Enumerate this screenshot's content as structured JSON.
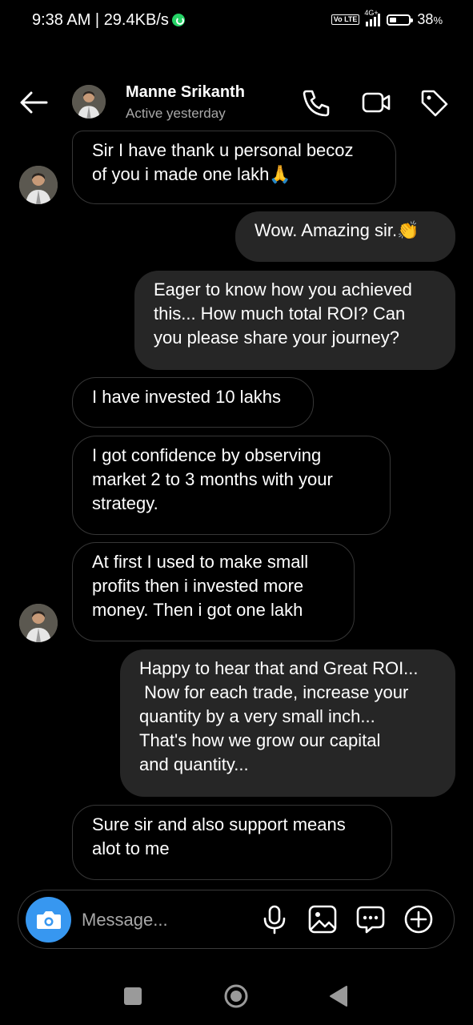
{
  "status_bar": {
    "time": "9:38 AM | 29.4KB/s",
    "volte": "Vo LTE",
    "network": "4G+",
    "battery": "38",
    "battery_unit": "%",
    "battery_level": 0.38,
    "icons": [
      "whatsapp-icon",
      "volte-icon",
      "signal-icon",
      "battery-icon"
    ]
  },
  "header": {
    "name": "Manne Srikanth",
    "status": "Active yesterday",
    "icons": [
      "back-arrow-icon",
      "phone-icon",
      "video-call-icon",
      "tag-icon"
    ]
  },
  "messages": [
    {
      "from": "them",
      "lines": [
        "Sir I have thank u personal becoz",
        "of you i made one lakh🙏"
      ],
      "show_avatar": true
    },
    {
      "from": "me",
      "lines": [
        "Wow. Amazing sir.👏"
      ]
    },
    {
      "from": "me",
      "lines": [
        "Eager to know how you achieved",
        "this... How much total ROI? Can",
        "you please share your journey?"
      ]
    },
    {
      "from": "them",
      "lines": [
        "I have invested 10 lakhs"
      ]
    },
    {
      "from": "them",
      "lines": [
        "I got confidence by observing",
        "market  2 to  3 months with your",
        "strategy."
      ]
    },
    {
      "from": "them",
      "lines": [
        "At first I used to make small",
        "profits then i invested more",
        "money. Then i got one lakh"
      ],
      "show_avatar": true
    },
    {
      "from": "me",
      "lines": [
        "Happy to hear that and Great ROI...",
        " Now for each trade, increase your",
        "quantity by a very small inch...",
        "That's how we grow our capital",
        "and quantity..."
      ]
    },
    {
      "from": "them",
      "lines": [
        "Sure sir and also support means",
        "alot to me"
      ]
    }
  ],
  "composer": {
    "placeholder": "Message...",
    "icons": [
      "camera-icon",
      "microphone-icon",
      "gallery-icon",
      "sticker-icon",
      "add-icon"
    ]
  },
  "nav_bar": {
    "icons": [
      "recents-icon",
      "home-icon",
      "back-icon"
    ]
  },
  "colors": {
    "background": "#000000",
    "outgoing_bubble": "#262626",
    "incoming_border": "#363636",
    "camera_button": "#3797f0",
    "secondary_text": "#a8a8a8"
  }
}
